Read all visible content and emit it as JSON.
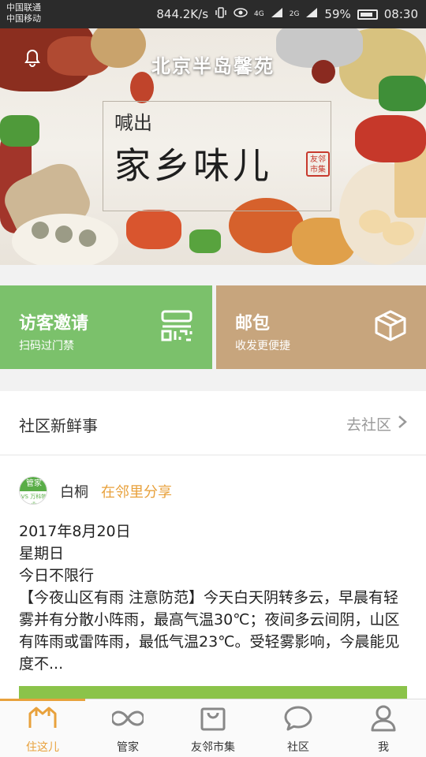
{
  "status_bar": {
    "carrier_1": "中国联通",
    "carrier_2": "中国移动",
    "speed": "844.2K/s",
    "network_4g": "4G",
    "network_2g": "2G",
    "battery": "59%",
    "time": "08:30"
  },
  "banner": {
    "community_name": "北京半岛馨苑",
    "slogan_small": "喊出",
    "slogan_big": "家乡味儿",
    "seal_text": "友邻市集"
  },
  "actions": [
    {
      "title": "访客邀请",
      "subtitle": "扫码过门禁",
      "icon": "qr-code-icon",
      "color": "#7bc16b"
    },
    {
      "title": "邮包",
      "subtitle": "收发更便捷",
      "icon": "package-box-icon",
      "color": "#c7a57d"
    }
  ],
  "community": {
    "section_title": "社区新鲜事",
    "link_label": "去社区"
  },
  "post": {
    "avatar_label": "管家",
    "avatar_sub": "VS 万科物业",
    "author": "白桐",
    "share_label": "在邻里分享",
    "line_1": "2017年8月20日",
    "line_2": "星期日",
    "line_3": "今日不限行",
    "line_4": "【今夜山区有雨 注意防范】今天白天阴转多云，早晨有轻雾并有分散小阵雨，最高气温30℃；夜间多云间阴，山区有阵雨或雷阵雨，最低气温23℃。受轻雾影响，今晨能见度不..."
  },
  "tabs": [
    {
      "label": "住这儿",
      "icon": "home-icon",
      "active": true
    },
    {
      "label": "管家",
      "icon": "infinity-icon",
      "active": false
    },
    {
      "label": "友邻市集",
      "icon": "shopping-bag-icon",
      "active": false
    },
    {
      "label": "社区",
      "icon": "chat-bubble-icon",
      "active": false
    },
    {
      "label": "我",
      "icon": "person-icon",
      "active": false
    }
  ],
  "colors": {
    "accent": "#e8a13c",
    "green": "#7bc16b",
    "tan": "#c7a57d"
  }
}
